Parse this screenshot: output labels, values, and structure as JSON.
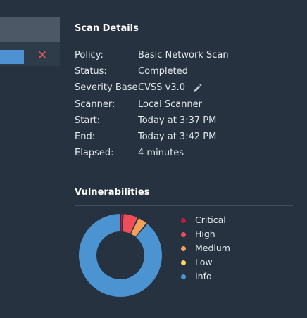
{
  "details": {
    "title": "Scan Details",
    "rows": [
      {
        "key": "Policy:",
        "value": "Basic Network Scan"
      },
      {
        "key": "Status:",
        "value": "Completed"
      },
      {
        "key": "Severity Base:",
        "value": "CVSS v3.0"
      },
      {
        "key": "Scanner:",
        "value": "Local Scanner"
      },
      {
        "key": "Start:",
        "value": "Today at 3:37 PM"
      },
      {
        "key": "End:",
        "value": "Today at 3:42 PM"
      },
      {
        "key": "Elapsed:",
        "value": "4 minutes"
      }
    ],
    "edit_icon": "pencil-icon"
  },
  "left_panel": {
    "close_icon": "close-icon",
    "accent_color": "#4e92d4",
    "close_color": "#e05a5d"
  },
  "vulnerabilities": {
    "title": "Vulnerabilities",
    "legend": [
      {
        "label": "Critical",
        "color": "#c8193c"
      },
      {
        "label": "High",
        "color": "#ee4d5b"
      },
      {
        "label": "Medium",
        "color": "#f4a15a"
      },
      {
        "label": "Low",
        "color": "#fbd55c"
      },
      {
        "label": "Info",
        "color": "#4b93d1"
      }
    ],
    "chart_data": {
      "type": "pie",
      "categories": [
        "Critical",
        "High",
        "Medium",
        "Low",
        "Info"
      ],
      "values": [
        1,
        6,
        4,
        0,
        89
      ]
    }
  }
}
